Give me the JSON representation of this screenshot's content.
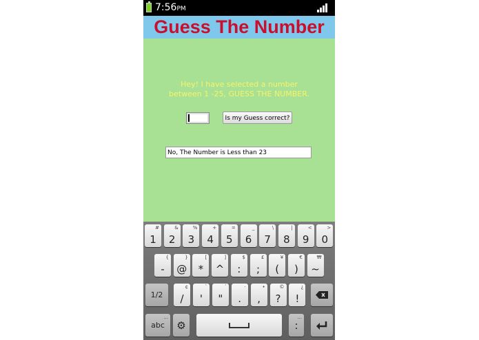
{
  "status_bar": {
    "time": "7:56",
    "ampm": "PM"
  },
  "title": "Guess The Number",
  "message_line1": "Hey! I have selected a number",
  "message_line2": "between 1 -25, GUESS THE NUMBER.",
  "guess_input": {
    "value": ""
  },
  "check_button_label": "Is my Guess correct?",
  "result_text": "No, The Number is Less than 23",
  "keyboard": {
    "row1": [
      {
        "main": "1",
        "sub": "#"
      },
      {
        "main": "2",
        "sub": "&"
      },
      {
        "main": "3",
        "sub": "%"
      },
      {
        "main": "4",
        "sub": "+"
      },
      {
        "main": "5",
        "sub": "="
      },
      {
        "main": "6",
        "sub": "_"
      },
      {
        "main": "7",
        "sub": "\\"
      },
      {
        "main": "8",
        "sub": "|"
      },
      {
        "main": "9",
        "sub": "<"
      },
      {
        "main": "0",
        "sub": ">"
      }
    ],
    "row2": [
      {
        "main": "-",
        "sub": "{"
      },
      {
        "main": "@",
        "sub": "}"
      },
      {
        "main": "*",
        "sub": "["
      },
      {
        "main": "^",
        "sub": "]"
      },
      {
        "main": ":",
        "sub": "$"
      },
      {
        "main": ";",
        "sub": "£"
      },
      {
        "main": "(",
        "sub": "¥"
      },
      {
        "main": ")",
        "sub": "€"
      },
      {
        "main": "~",
        "sub": "₩"
      }
    ],
    "row3_left": "1/2",
    "row3": [
      {
        "main": "/",
        "sub": "¢"
      },
      {
        "main": "'",
        "sub": "`"
      },
      {
        "main": "\"",
        "sub": "´"
      },
      {
        "main": ".",
        "sub": "·"
      },
      {
        "main": ",",
        "sub": "•"
      },
      {
        "main": "?",
        "sub": "©"
      },
      {
        "main": "!",
        "sub": "¿"
      }
    ],
    "backspace_icon": "backspace-icon",
    "abc_label": "abc",
    "settings_icon": "gear-icon",
    "space_icon": "space-icon",
    "colon_key": ":",
    "enter_icon": "enter-icon"
  }
}
